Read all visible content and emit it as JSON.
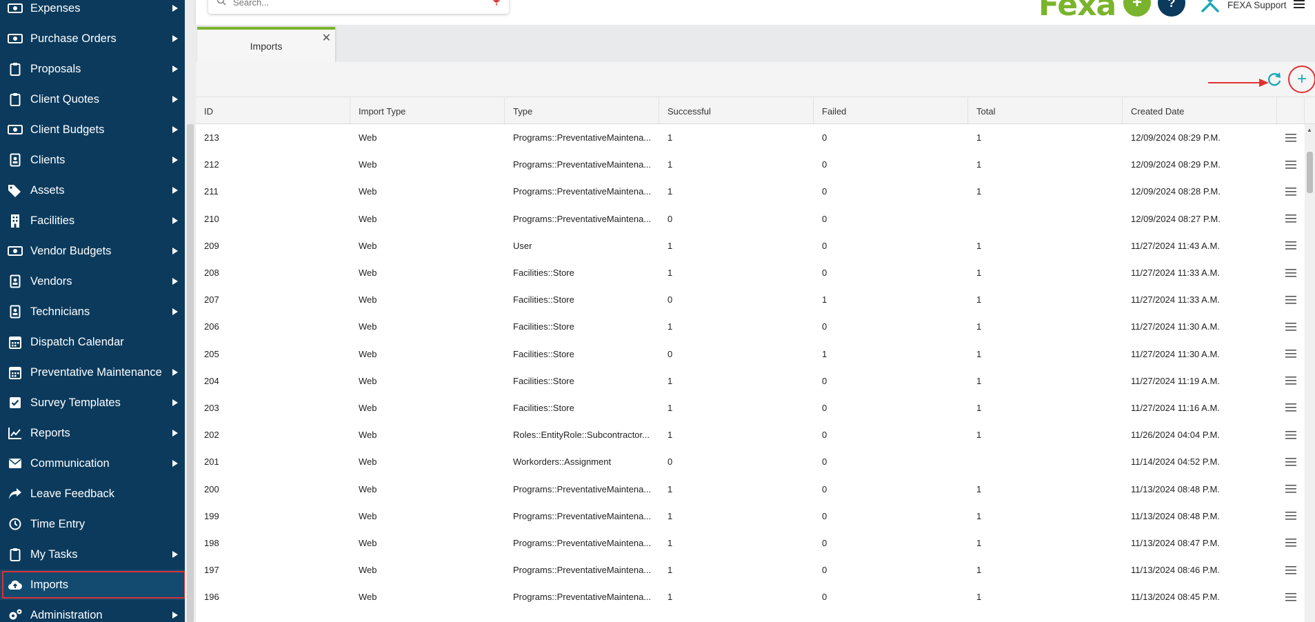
{
  "sidebar": {
    "items": [
      {
        "label": "Expenses",
        "icon": "money-icon",
        "arrow": true
      },
      {
        "label": "Purchase Orders",
        "icon": "money-icon",
        "arrow": true
      },
      {
        "label": "Proposals",
        "icon": "clipboard-icon",
        "arrow": true
      },
      {
        "label": "Client Quotes",
        "icon": "clipboard-icon",
        "arrow": true
      },
      {
        "label": "Client Budgets",
        "icon": "money-icon",
        "arrow": true
      },
      {
        "label": "Clients",
        "icon": "id-card-icon",
        "arrow": true
      },
      {
        "label": "Assets",
        "icon": "tags-icon",
        "arrow": true
      },
      {
        "label": "Facilities",
        "icon": "building-icon",
        "arrow": true
      },
      {
        "label": "Vendor Budgets",
        "icon": "money-icon",
        "arrow": true
      },
      {
        "label": "Vendors",
        "icon": "id-card-icon",
        "arrow": true
      },
      {
        "label": "Technicians",
        "icon": "id-card-icon",
        "arrow": true
      },
      {
        "label": "Dispatch Calendar",
        "icon": "calendar-icon",
        "arrow": false
      },
      {
        "label": "Preventative Maintenance",
        "icon": "calendar-icon",
        "arrow": true
      },
      {
        "label": "Survey Templates",
        "icon": "checkbox-icon",
        "arrow": true
      },
      {
        "label": "Reports",
        "icon": "chart-line-icon",
        "arrow": true
      },
      {
        "label": "Communication",
        "icon": "envelope-icon",
        "arrow": true
      },
      {
        "label": "Leave Feedback",
        "icon": "share-icon",
        "arrow": false
      },
      {
        "label": "Time Entry",
        "icon": "clock-icon",
        "arrow": false
      },
      {
        "label": "My Tasks",
        "icon": "clipboard-icon",
        "arrow": true
      },
      {
        "label": "Imports",
        "icon": "cloud-upload-icon",
        "arrow": false,
        "active": true
      },
      {
        "label": "Administration",
        "icon": "gears-icon",
        "arrow": true
      }
    ]
  },
  "header": {
    "search_placeholder": "Search...",
    "brand": "Fexa",
    "help_label": "?",
    "add_label": "+",
    "user_name": "FEXA Support"
  },
  "tabs": [
    {
      "label": "Imports",
      "close": "✕"
    }
  ],
  "toolbar": {
    "add_label": "+"
  },
  "table": {
    "columns": [
      "ID",
      "Import Type",
      "Type",
      "Successful",
      "Failed",
      "Total",
      "Created Date"
    ],
    "rows": [
      [
        "213",
        "Web",
        "Programs::PreventativeMaintena...",
        "1",
        "0",
        "1",
        "12/09/2024 08:29 P.M."
      ],
      [
        "212",
        "Web",
        "Programs::PreventativeMaintena...",
        "1",
        "0",
        "1",
        "12/09/2024 08:29 P.M."
      ],
      [
        "211",
        "Web",
        "Programs::PreventativeMaintena...",
        "1",
        "0",
        "1",
        "12/09/2024 08:28 P.M."
      ],
      [
        "210",
        "Web",
        "Programs::PreventativeMaintena...",
        "0",
        "0",
        "",
        "12/09/2024 08:27 P.M."
      ],
      [
        "209",
        "Web",
        "User",
        "1",
        "0",
        "1",
        "11/27/2024 11:43 A.M."
      ],
      [
        "208",
        "Web",
        "Facilities::Store",
        "1",
        "0",
        "1",
        "11/27/2024 11:33 A.M."
      ],
      [
        "207",
        "Web",
        "Facilities::Store",
        "0",
        "1",
        "1",
        "11/27/2024 11:33 A.M."
      ],
      [
        "206",
        "Web",
        "Facilities::Store",
        "1",
        "0",
        "1",
        "11/27/2024 11:30 A.M."
      ],
      [
        "205",
        "Web",
        "Facilities::Store",
        "0",
        "1",
        "1",
        "11/27/2024 11:30 A.M."
      ],
      [
        "204",
        "Web",
        "Facilities::Store",
        "1",
        "0",
        "1",
        "11/27/2024 11:19 A.M."
      ],
      [
        "203",
        "Web",
        "Facilities::Store",
        "1",
        "0",
        "1",
        "11/27/2024 11:16 A.M."
      ],
      [
        "202",
        "Web",
        "Roles::EntityRole::Subcontractor...",
        "1",
        "0",
        "1",
        "11/26/2024 04:04 P.M."
      ],
      [
        "201",
        "Web",
        "Workorders::Assignment",
        "0",
        "0",
        "",
        "11/14/2024 04:52 P.M."
      ],
      [
        "200",
        "Web",
        "Programs::PreventativeMaintena...",
        "1",
        "0",
        "1",
        "11/13/2024 08:48 P.M."
      ],
      [
        "199",
        "Web",
        "Programs::PreventativeMaintena...",
        "1",
        "0",
        "1",
        "11/13/2024 08:48 P.M."
      ],
      [
        "198",
        "Web",
        "Programs::PreventativeMaintena...",
        "1",
        "0",
        "1",
        "11/13/2024 08:47 P.M."
      ],
      [
        "197",
        "Web",
        "Programs::PreventativeMaintena...",
        "1",
        "0",
        "1",
        "11/13/2024 08:46 P.M."
      ],
      [
        "196",
        "Web",
        "Programs::PreventativeMaintena...",
        "1",
        "0",
        "1",
        "11/13/2024 08:45 P.M."
      ]
    ]
  },
  "colors": {
    "sidebar_bg": "#0b3a5c",
    "brand_green": "#7ab42c",
    "accent_teal": "#1ba9b5",
    "highlight_red": "#e03131"
  }
}
